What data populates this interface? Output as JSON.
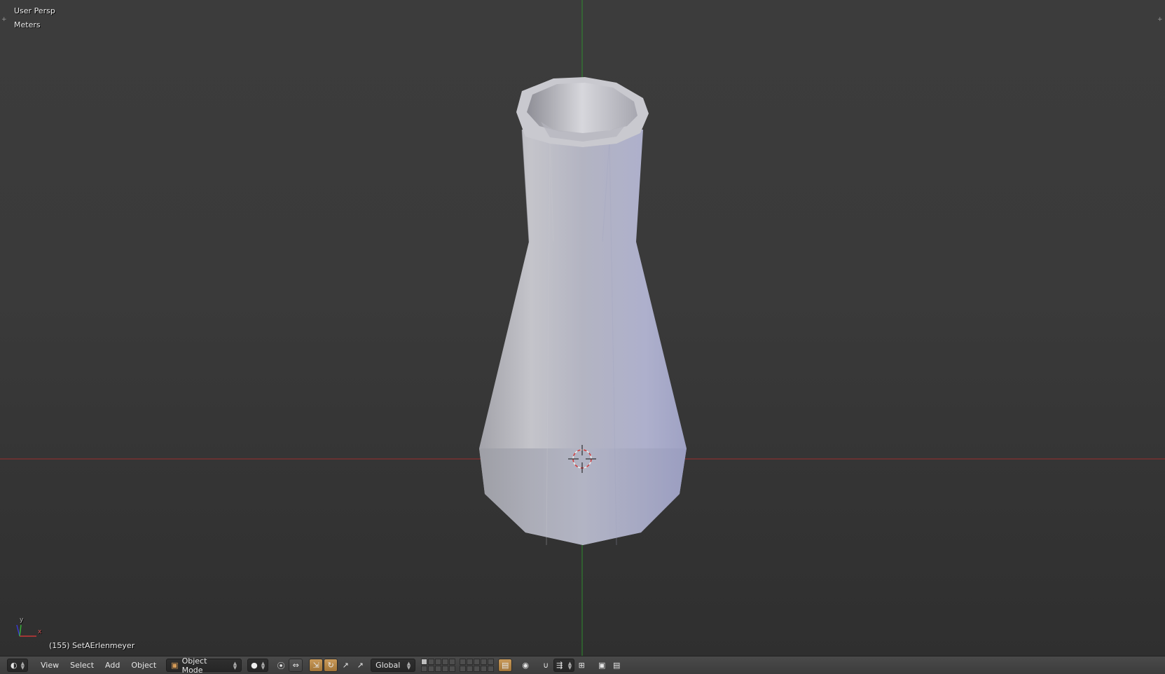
{
  "viewport": {
    "view_label": "User Persp",
    "units_label": "Meters",
    "object_info": "(155) SetAErlenmeyer",
    "axis_labels": {
      "x": "x",
      "y": "y"
    },
    "colors": {
      "x_axis": "#b23232",
      "y_axis": "#2f9c2f",
      "object": "#b7b9c8"
    }
  },
  "header": {
    "editor_type_icon": "3d-view-icon",
    "menus": {
      "view": "View",
      "select": "Select",
      "add": "Add",
      "object": "Object"
    },
    "mode": {
      "label": "Object Mode",
      "icon": "cube-icon"
    },
    "viewport_shading_icon": "solid-shading-icon",
    "pivot_icon": "pivot-point-icon",
    "transform_orientation": "Global",
    "manipulator_icons": [
      "translate-icon",
      "rotate-icon",
      "scale-icon"
    ]
  }
}
